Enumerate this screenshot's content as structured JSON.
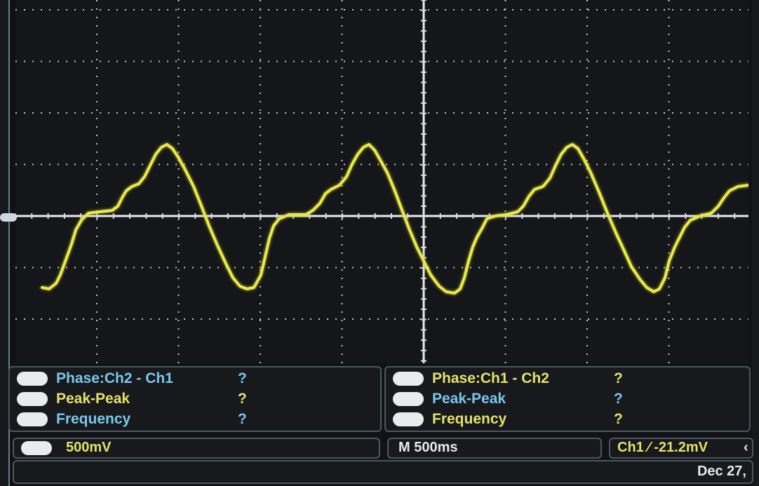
{
  "measurements_left": {
    "rows": [
      {
        "name": "Phase:Ch2 - Ch1",
        "value": "?",
        "name_color": "#78c8ea",
        "value_color": "#78c8ea"
      },
      {
        "name": "Peak-Peak",
        "value": "?",
        "name_color": "#e4e26a",
        "value_color": "#e4e26a"
      },
      {
        "name": "Frequency",
        "value": "?",
        "name_color": "#78c8ea",
        "value_color": "#78c8ea"
      }
    ]
  },
  "measurements_right": {
    "rows": [
      {
        "name": "Phase:Ch1 - Ch2",
        "value": "?",
        "name_color": "#e4e26a",
        "value_color": "#e4e26a"
      },
      {
        "name": "Peak-Peak",
        "value": "?",
        "name_color": "#78c8ea",
        "value_color": "#78c8ea"
      },
      {
        "name": "Frequency",
        "value": "?",
        "name_color": "#e4e26a",
        "value_color": "#e4e26a"
      }
    ]
  },
  "status": {
    "ch1_scale": "500mV",
    "timebase": "M 500ms",
    "trigger": "Ch1 ⁄ -21.2mV",
    "date": "Dec 27,"
  },
  "colors": {
    "trace": "#e8e84a",
    "cyan_text": "#78c8ea",
    "yellow_text": "#e4e26a"
  },
  "icons": {
    "channel_marker": "ground-marker-icon",
    "trigger_arrow": "trigger-arrow-icon"
  }
}
